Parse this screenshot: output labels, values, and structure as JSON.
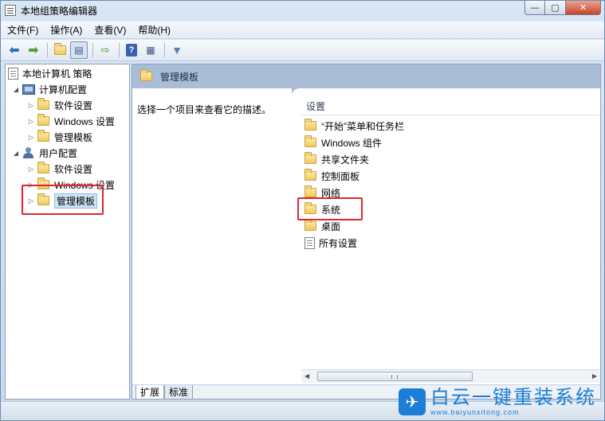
{
  "window": {
    "title": "本地组策略编辑器",
    "controls": {
      "minimize": "—",
      "maximize": "▢",
      "close": "✕"
    }
  },
  "menu": [
    "文件(F)",
    "操作(A)",
    "查看(V)",
    "帮助(H)"
  ],
  "toolbar": {
    "buttons": [
      "back-arrow-icon",
      "forward-arrow-icon",
      "up-folder-icon",
      "show-tree-icon",
      "export-icon",
      "help-icon",
      "properties-icon",
      "filter-icon"
    ]
  },
  "tree": {
    "root": "本地计算机 策略",
    "computer_config": "计算机配置",
    "computer_children": [
      "软件设置",
      "Windows 设置",
      "管理模板"
    ],
    "user_config": "用户配置",
    "user_children": [
      "软件设置",
      "Windows 设置",
      "管理模板"
    ]
  },
  "right_pane": {
    "header_title": "管理模板",
    "description": "选择一个项目来查看它的描述。",
    "column_header": "设置",
    "items": [
      "“开始”菜单和任务栏",
      "Windows 组件",
      "共享文件夹",
      "控制面板",
      "网络",
      "系统",
      "桌面",
      "所有设置"
    ]
  },
  "tabs": [
    "扩展",
    "标准"
  ],
  "watermark": {
    "title": "白云一键重装系统",
    "url": "www.baiyunxitong.com"
  },
  "colors": {
    "highlight": "#e0262b",
    "header_band": "#a9bed6",
    "watermark": "#1c7ed6"
  }
}
